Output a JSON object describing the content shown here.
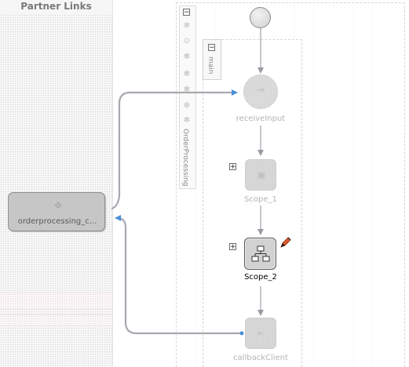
{
  "partner_links": {
    "header": "Partner Links",
    "link_label": "orderprocessing_c..."
  },
  "process": {
    "name": "OrderProcessing",
    "sequence_label": "main",
    "collapse_symbol": "−",
    "expand_symbol": "+"
  },
  "activities": {
    "receive": "receiveInput",
    "scope1": "Scope_1",
    "scope2": "Scope_2",
    "callback": "callbackClient"
  },
  "colors": {
    "flow_line": "#a8a8b0",
    "link_arrow": "#4a90d9",
    "pencil": "#e05a2a"
  },
  "icons": {
    "start": "start-circle-icon",
    "receive": "receive-icon",
    "scope1": "scope-icon",
    "scope2": "scope-hierarchy-icon",
    "edit": "pencil-icon",
    "partner": "partner-link-icon",
    "variables": "variables-icon"
  }
}
